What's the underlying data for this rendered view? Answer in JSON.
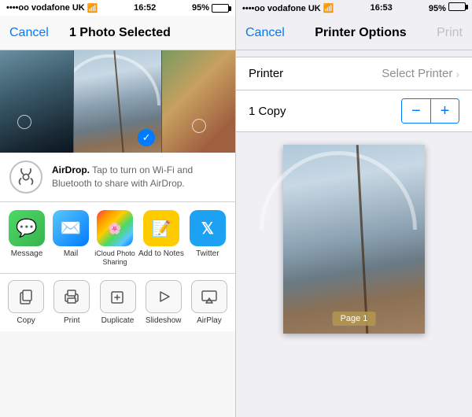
{
  "left": {
    "status": {
      "carrier": "••••oo vodafone UK",
      "wifi": "WiFi",
      "time": "16:52",
      "battery_pct": "95%"
    },
    "nav": {
      "cancel": "Cancel",
      "title": "1 Photo Selected"
    },
    "airdrop": {
      "label": "AirDrop.",
      "description": " Tap to turn on Wi-Fi and Bluetooth to share with AirDrop."
    },
    "apps": [
      {
        "id": "message",
        "label": "Message"
      },
      {
        "id": "mail",
        "label": "Mail"
      },
      {
        "id": "icloud",
        "label": "iCloud Photo\nSharing"
      },
      {
        "id": "notes",
        "label": "Add to Notes"
      },
      {
        "id": "twitter",
        "label": "Twitter"
      }
    ],
    "actions": [
      {
        "id": "copy",
        "label": "Copy"
      },
      {
        "id": "print",
        "label": "Print"
      },
      {
        "id": "duplicate",
        "label": "Duplicate"
      },
      {
        "id": "slideshow",
        "label": "Slideshow"
      },
      {
        "id": "airplay",
        "label": "AirPlay"
      }
    ]
  },
  "right": {
    "status": {
      "carrier": "••••oo vodafone UK",
      "wifi": "WiFi",
      "time": "16:53",
      "battery_pct": "95%"
    },
    "nav": {
      "cancel": "Cancel",
      "title": "Printer Options",
      "print": "Print"
    },
    "printer_label": "Printer",
    "printer_value": "Select Printer",
    "copy_label": "1 Copy",
    "stepper_minus": "−",
    "stepper_plus": "+",
    "page_badge": "Page 1"
  }
}
